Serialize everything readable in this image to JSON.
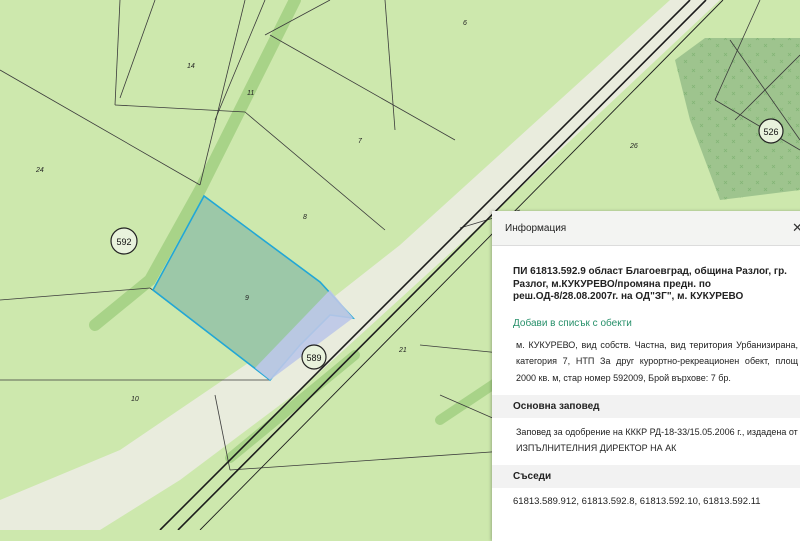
{
  "map": {
    "parcel_labels": [
      "6",
      "14",
      "11",
      "24",
      "7",
      "26",
      "8",
      "9",
      "21",
      "10"
    ],
    "circle_labels": [
      "592",
      "589",
      "526"
    ],
    "colors": {
      "land": "#cde8ad",
      "road": "#e9ecdd",
      "strip": "#a8d388",
      "forest": "#9ec48e",
      "selection_fill": "#9cc8a8",
      "selection_stroke": "#22a7d6",
      "selection_road": "#bcc8e8"
    }
  },
  "info_panel": {
    "header": "Информация",
    "close_icon": "✕",
    "title": "ПИ 61813.592.9 област Благоевград, община Разлог, гр. Разлог, м.КУКУРЕВО/промяна предн. по реш.ОД-8/28.08.2007г. на ОД\"ЗГ\", м. КУКУРЕВО",
    "add_link": "Добави в списък с обекти",
    "description": "м. КУКУРЕВО, вид собств. Частна, вид територия Урбанизирана, категория 7, НТП За друг курортно-рекреационен обект, площ 2000 кв. м, стар номер 592009, Брой върхове: 7 бр.",
    "main_order_heading": "Основна заповед",
    "main_order_text": "Заповед за одобрение на КККР РД-18-33/15.05.2006 г., издадена от ИЗПЪЛНИТЕЛНИЯ ДИРЕКТОР НА АК",
    "neighbors_heading": "Съседи",
    "neighbors": "61813.589.912, 61813.592.8, 61813.592.10, 61813.592.11"
  }
}
